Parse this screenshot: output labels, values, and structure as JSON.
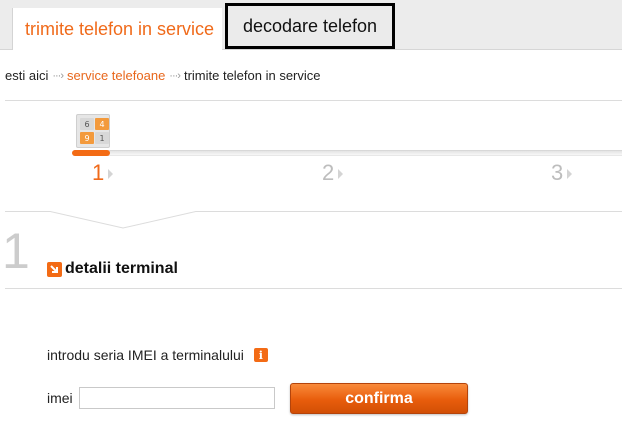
{
  "tabs": {
    "inactive_label": "trimite telefon in service",
    "active_label": "decodare telefon"
  },
  "breadcrumb": {
    "home": "esti aici",
    "section": "service telefoane",
    "current": "trimite telefon in service"
  },
  "progress": {
    "steps": [
      "1",
      "2",
      "3"
    ],
    "current_step": 1,
    "icon_cells": [
      "6",
      "4",
      "9",
      "1"
    ]
  },
  "section": {
    "number": "1",
    "title": "detalii terminal"
  },
  "form": {
    "instruction": "introdu seria IMEI a terminalului",
    "imei_label": "imei",
    "imei_value": "",
    "confirm_label": "confirma"
  },
  "colors": {
    "accent": "#f36b15",
    "active_tab_border": "#000000",
    "muted": "#cccccc"
  },
  "icons": {
    "breadcrumb_separator": "dotted-arrow-icon",
    "section_marker": "arrow-down-right-icon",
    "info": "info-icon"
  }
}
